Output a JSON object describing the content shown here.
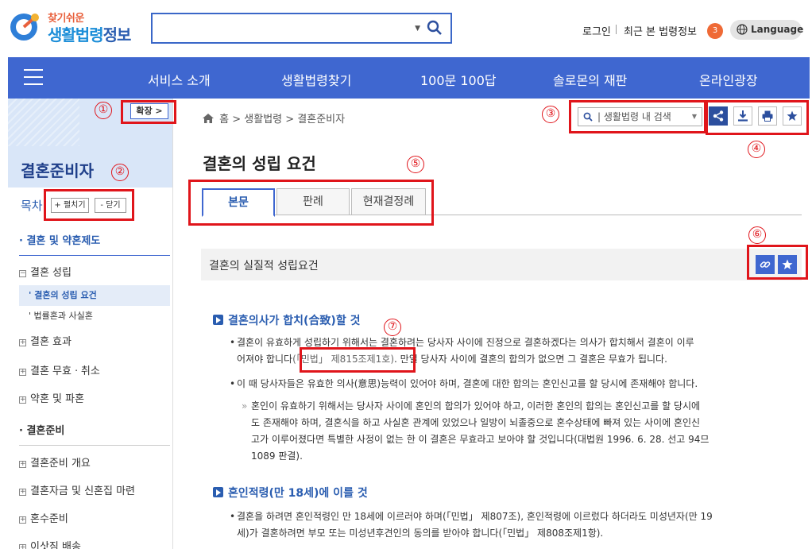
{
  "header": {
    "logo_small": "찾기쉬운",
    "logo_big_a": "생활법령",
    "logo_big_b": "정보",
    "login": "로그인",
    "recent": "최근 본 법령정보",
    "recent_count": "3",
    "language": "Language"
  },
  "nav": {
    "items": [
      "서비스 소개",
      "생활법령찾기",
      "100문 100답",
      "솔로몬의 재판",
      "온라인광장"
    ]
  },
  "sidebar": {
    "expand_label": "확장 >",
    "title": "결혼준비자",
    "toc_label": "목차",
    "open_all": "+ 펼치기",
    "close_all": "- 닫기",
    "items": [
      "결혼 및 약혼제도",
      "결혼 성립",
      "결혼의 성립 요건",
      "법률혼과 사실혼",
      "결혼 효과",
      "결혼 무효ㆍ취소",
      "약혼 및 파혼",
      "결혼준비",
      "결혼준비 개요",
      "결혼자금 및 신혼집 마련",
      "혼수준비",
      "이삿짐 배송"
    ]
  },
  "breadcrumb": {
    "home": "홈",
    "level1": "생활법령",
    "level2": "결혼준비자"
  },
  "inner_search": {
    "placeholder": "생활법령 내 검색"
  },
  "page": {
    "title": "결혼의 성립 요건",
    "tabs": [
      "본문",
      "판례",
      "현재결정례"
    ],
    "section_title": "결혼의 실질적 성립요건",
    "h1": "결혼의사가 합치(合致)할 것",
    "p1_a": "결혼이 유효하게 성립하기 위해서는 결혼하려는 당사자 사이에 진정으로 결혼하겠다는 의사가 합치해서 결혼이 이루",
    "p1_b_pre": "어져야 합니다",
    "p1_ref": "(「민법」 제815조제1호)",
    "p1_b_post": ". 만일 당사자 사이에 결혼의 합의가 없으면 그 결혼은 무효가 됩니다.",
    "p2": "이 때 당사자들은 유효한 의사(意思)능력이 있어야 하며, 결혼에 대한 합의는 혼인신고를 할 당시에 존재해야 합니다.",
    "p3_a": "혼인이 유효하기 위해서는 당사자 사이에 혼인의 합의가 있어야 하고, 이러한 혼인의 합의는 혼인신고를 할 당시에",
    "p3_b": "도 존재해야 하며, 결혼식을 하고 사실혼 관계에 있었으나 일방이 뇌졸중으로 혼수상태에 빠져 있는 사이에 혼인신",
    "p3_c": "고가 이루어졌다면 특별한 사정이 없는 한 이 결혼은 무효라고 보아야 할 것입니다(대법원 1996. 6. 28. 선고 94므",
    "p3_d": "1089 판결).",
    "h2": "혼인적령(만 18세)에 이를 것",
    "p4_a": "결혼을 하려면 혼인적령인 만 18세에 이르러야 하며(「민법」 제807조), 혼인적령에 이르렀다 하더라도 미성년자(만 19",
    "p4_b": "세)가 결혼하려면 부모 또는 미성년후견인의 동의를 받아야 합니다(「민법」 제808조제1항)."
  },
  "annotations": [
    "①",
    "②",
    "③",
    "④",
    "⑤",
    "⑥",
    "⑦"
  ],
  "colors": {
    "nav": "#3f67d0",
    "accent": "#2a5db0",
    "annotation": "#e0151b"
  }
}
